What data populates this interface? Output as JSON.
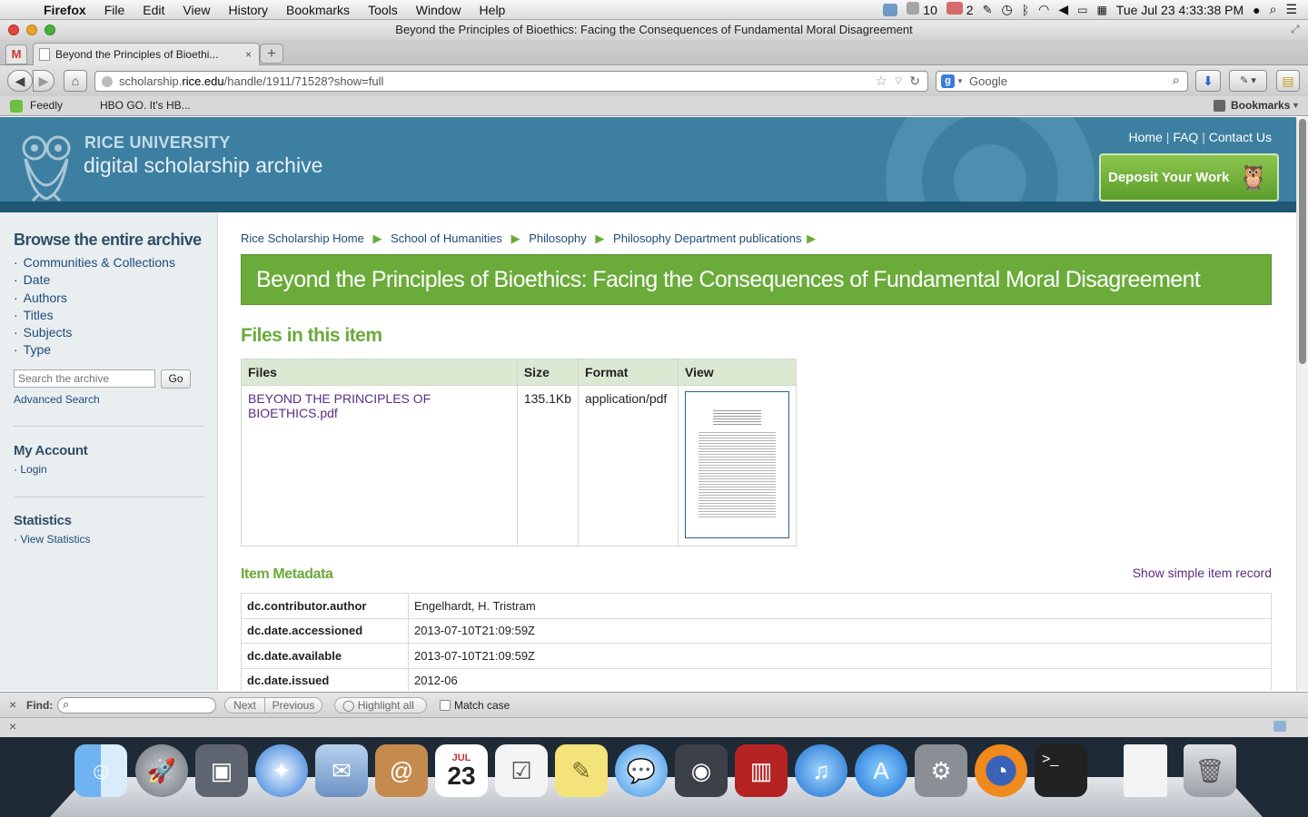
{
  "menubar": {
    "app": "Firefox",
    "items": [
      "File",
      "Edit",
      "View",
      "History",
      "Bookmarks",
      "Tools",
      "Window",
      "Help"
    ],
    "cal_count": "10",
    "mail_count": "2",
    "clock": "Tue Jul 23  4:33:38 PM"
  },
  "window": {
    "title": "Beyond the Principles of Bioethics: Facing the Consequences of Fundamental Moral Disagreement"
  },
  "tabs": [
    {
      "label": "Beyond the Principles of Bioethi..."
    }
  ],
  "nav": {
    "url_prefix": "scholarship.",
    "url_domain": "rice.edu",
    "url_path": "/handle/1911/71528?show=full",
    "search_placeholder": "Google"
  },
  "bookmarks": {
    "items": [
      "Feedly",
      "HBO GO. It's HB..."
    ],
    "menu": "Bookmarks"
  },
  "site": {
    "brand_top": "RICE UNIVERSITY",
    "brand_bottom": "digital scholarship archive",
    "toplinks": [
      "Home",
      "FAQ",
      "Contact Us"
    ],
    "deposit": "Deposit Your Work"
  },
  "sidebar": {
    "browse_heading": "Browse the entire archive",
    "browse_items": [
      "Communities & Collections",
      "Date",
      "Authors",
      "Titles",
      "Subjects",
      "Type"
    ],
    "search_placeholder": "Search the archive",
    "go": "Go",
    "advanced": "Advanced Search",
    "account_heading": "My Account",
    "login": "Login",
    "stats_heading": "Statistics",
    "view_stats": "View Statistics"
  },
  "breadcrumb": [
    "Rice Scholarship Home",
    "School of Humanities",
    "Philosophy",
    "Philosophy Department publications"
  ],
  "item_title": "Beyond the Principles of Bioethics: Facing the Consequences of Fundamental Moral Disagreement",
  "files": {
    "heading": "Files in this item",
    "headers": [
      "Files",
      "Size",
      "Format",
      "View"
    ],
    "rows": [
      {
        "name": "BEYOND THE PRINCIPLES OF BIOETHICS.pdf",
        "size": "135.1Kb",
        "format": "application/pdf"
      }
    ]
  },
  "metadata": {
    "heading": "Item Metadata",
    "simple_link": "Show simple item record",
    "rows": [
      {
        "key": "dc.contributor.author",
        "value": "Engelhardt, H. Tristram"
      },
      {
        "key": "dc.date.accessioned",
        "value": "2013-07-10T21:09:59Z"
      },
      {
        "key": "dc.date.available",
        "value": "2013-07-10T21:09:59Z"
      },
      {
        "key": "dc.date.issued",
        "value": "2012-06"
      }
    ]
  },
  "findbar": {
    "label": "Find:",
    "next": "Next",
    "previous": "Previous",
    "highlight": "Highlight all",
    "match_case": "Match case"
  },
  "colors": {
    "banner": "#3d7fa1",
    "green": "#6aab3a",
    "title_bar": "#6aab3a"
  },
  "dock": {
    "icons": [
      "finder-icon",
      "launchpad-icon",
      "preview-icon",
      "safari-icon",
      "mail-icon",
      "contacts-icon",
      "calendar-icon",
      "reminders-icon",
      "notes-icon",
      "messages-icon",
      "facetime-icon",
      "photobooth-icon",
      "itunes-icon",
      "appstore-icon",
      "system-preferences-icon",
      "firefox-icon",
      "terminal-icon",
      "document-icon",
      "trash-icon"
    ],
    "calendar_month": "JUL",
    "calendar_day": "23"
  }
}
